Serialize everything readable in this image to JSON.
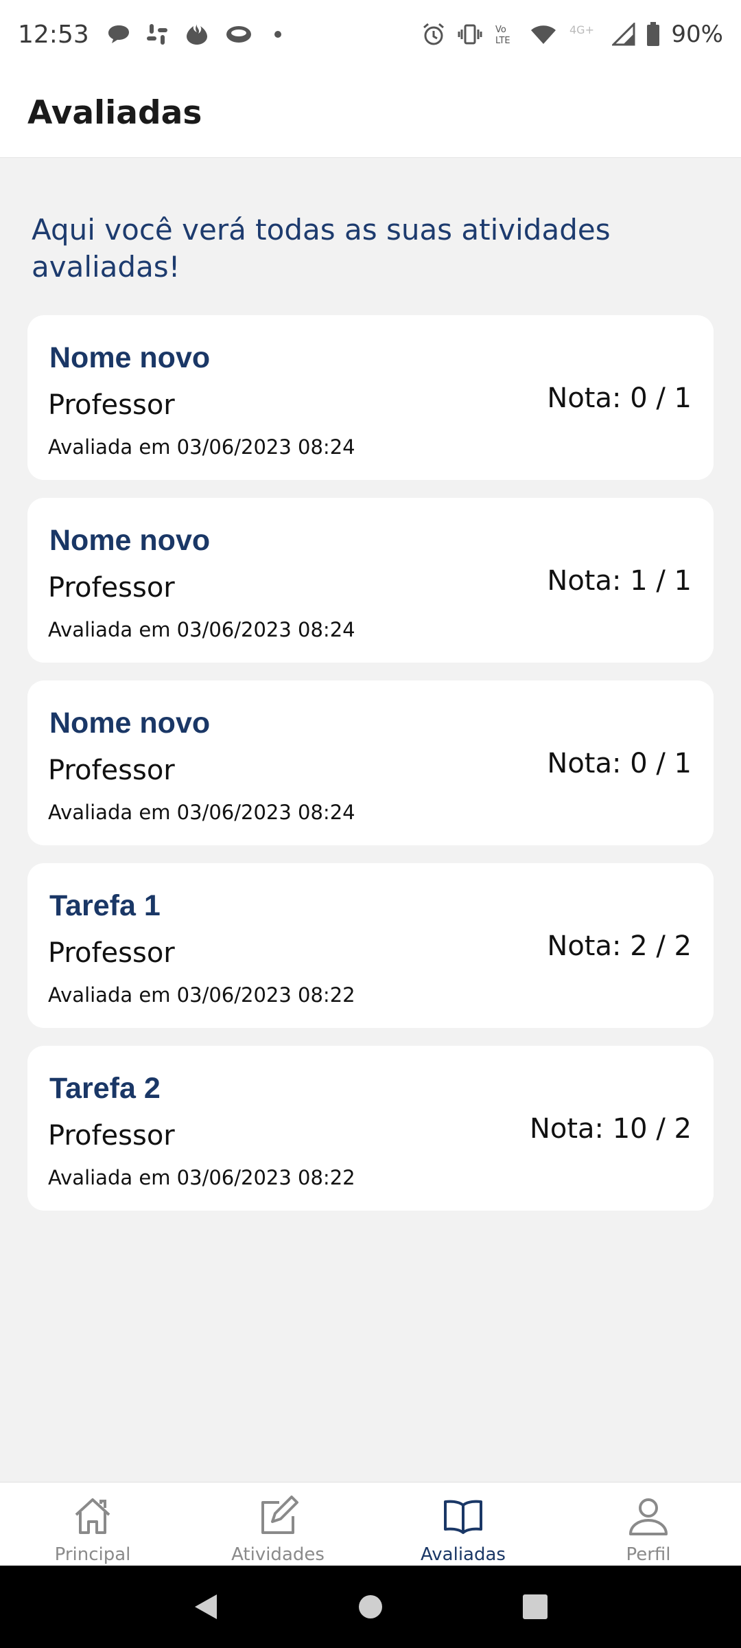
{
  "status_bar": {
    "time": "12:53",
    "battery": "90%",
    "notifications": [
      "chat-bubble-icon",
      "slack-icon",
      "santander-icon",
      "cloud-icon",
      "dot-icon"
    ],
    "system_icons": [
      "alarm-icon",
      "vibrate-icon",
      "volte-icon",
      "wifi-icon",
      "4g-icon",
      "signal-icon",
      "battery-icon"
    ]
  },
  "app_bar": {
    "title": "Avaliadas"
  },
  "intro": "Aqui você verá todas as suas atividades avaliadas!",
  "cards": [
    {
      "title": "Nome novo",
      "author": "Professor",
      "date": "Avaliada em 03/06/2023 08:24",
      "grade": "Nota: 0 / 1"
    },
    {
      "title": "Nome novo",
      "author": "Professor",
      "date": "Avaliada em 03/06/2023 08:24",
      "grade": "Nota: 1 / 1"
    },
    {
      "title": "Nome novo",
      "author": "Professor",
      "date": "Avaliada em 03/06/2023 08:24",
      "grade": "Nota: 0 / 1"
    },
    {
      "title": "Tarefa 1",
      "author": "Professor",
      "date": "Avaliada em 03/06/2023 08:22",
      "grade": "Nota: 2 / 2"
    },
    {
      "title": "Tarefa 2",
      "author": "Professor",
      "date": "Avaliada em 03/06/2023 08:22",
      "grade": "Nota: 10 / 2"
    }
  ],
  "bottom_nav": {
    "items": [
      {
        "label": "Principal",
        "icon": "home-icon",
        "active": false
      },
      {
        "label": "Atividades",
        "icon": "edit-icon",
        "active": false
      },
      {
        "label": "Avaliadas",
        "icon": "book-icon",
        "active": true
      },
      {
        "label": "Perfil",
        "icon": "person-icon",
        "active": false
      }
    ]
  },
  "colors": {
    "accent": "#1a3766",
    "intro_text": "#1d3b6e",
    "background": "#f2f2f2",
    "inactive": "#8a8a8a"
  }
}
